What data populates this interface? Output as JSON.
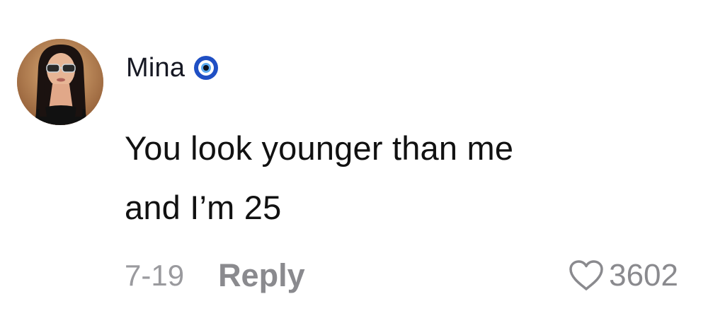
{
  "comment": {
    "username": "Mina",
    "username_badge_icon": "evil-eye-emoji-icon",
    "text_line1": "You look younger than me",
    "text_line2": "and I’m 25",
    "date": "7-19",
    "reply_label": "Reply",
    "like_icon": "heart-outline-icon",
    "like_count": "3602"
  },
  "colors": {
    "primary_text": "#161823",
    "secondary_text": "#8a8a8e",
    "evil_eye_blue": "#1f4fc4"
  }
}
